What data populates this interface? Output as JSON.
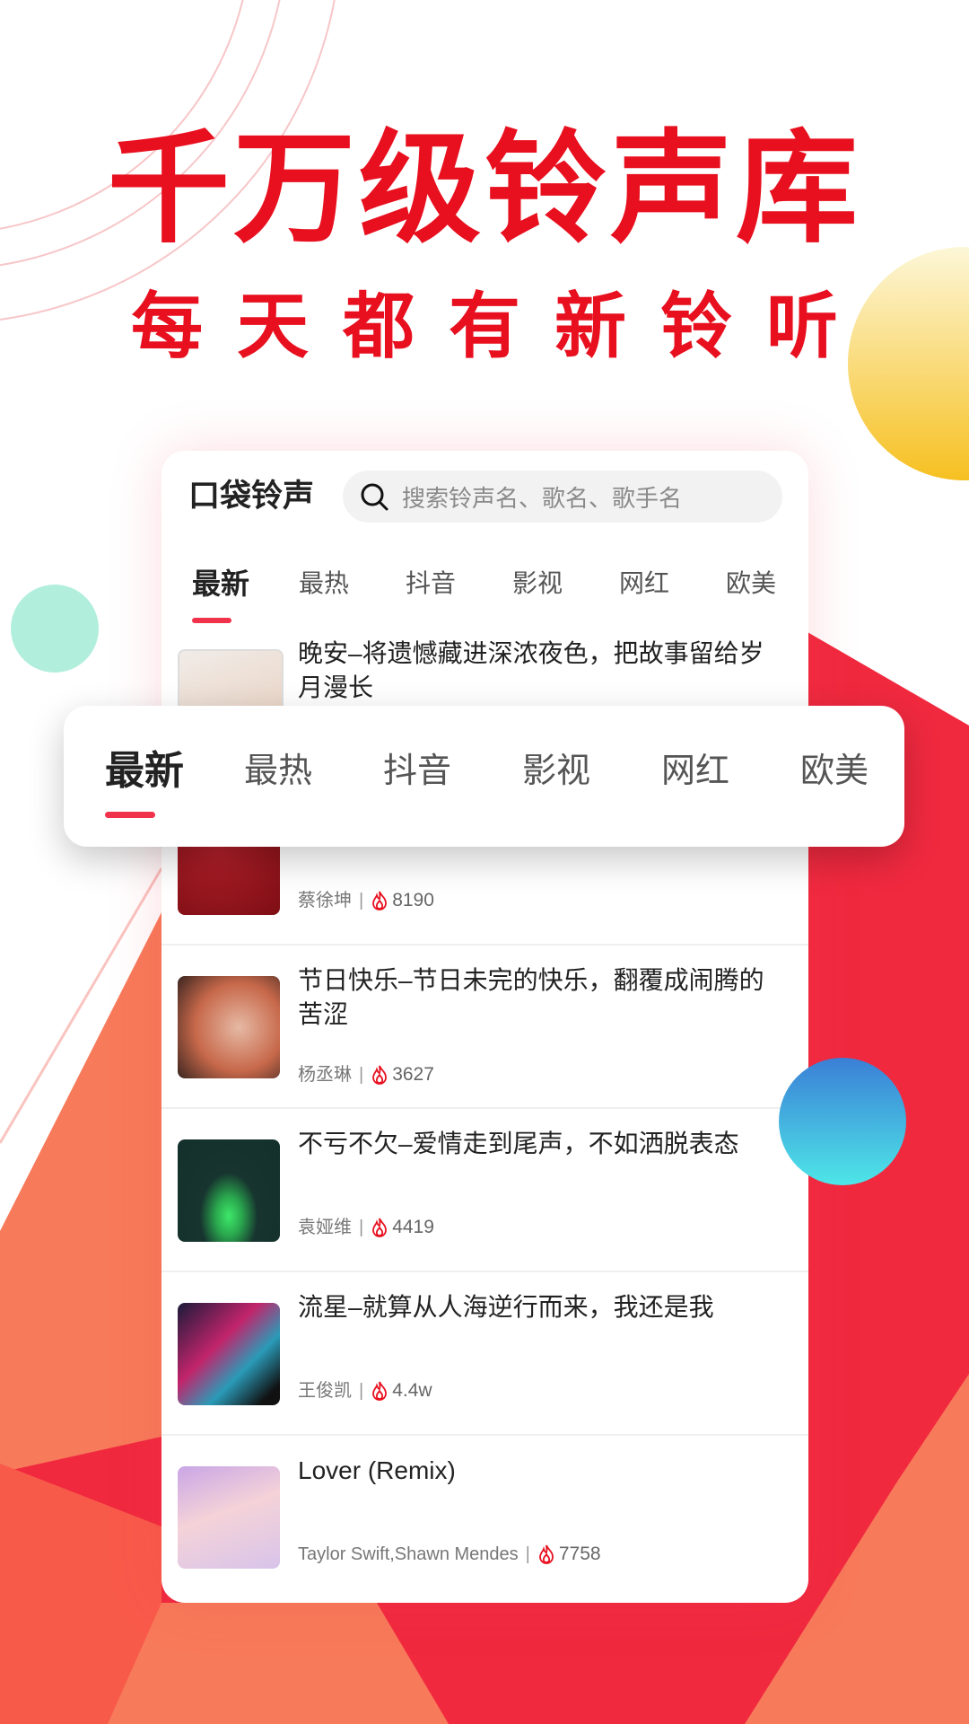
{
  "promo": {
    "headline": "千万级铃声库",
    "subheadline": "每天都有新铃听",
    "accent_color": "#e8101f"
  },
  "app": {
    "name": "口袋铃声",
    "search_placeholder": "搜索铃声名、歌名、歌手名",
    "search_icon": "search-icon"
  },
  "tabs": [
    {
      "label": "最新",
      "active": true
    },
    {
      "label": "最热",
      "active": false
    },
    {
      "label": "抖音",
      "active": false
    },
    {
      "label": "影视",
      "active": false
    },
    {
      "label": "网红",
      "active": false
    },
    {
      "label": "欧美",
      "active": false
    }
  ],
  "songs": [
    {
      "title": "晚安–将遗憾藏进深浓夜色，把故事留给岁月漫长",
      "artist": "",
      "plays": ""
    },
    {
      "title": "",
      "artist": "蔡徐坤",
      "plays": "8190"
    },
    {
      "title": "节日快乐–节日未完的快乐，翻覆成闹腾的苦涩",
      "artist": "杨丞琳",
      "plays": "3627"
    },
    {
      "title": "不亏不欠–爱情走到尾声，不如洒脱表态",
      "artist": "袁娅维",
      "plays": "4419"
    },
    {
      "title": "流星–就算从人海逆行而来，我还是我",
      "artist": "王俊凯",
      "plays": "4.4w"
    },
    {
      "title": "Lover (Remix)",
      "artist": "Taylor Swift,Shawn Mendes",
      "plays": "7758"
    }
  ],
  "meta_separator": "|",
  "hot_icon": "flame-icon",
  "colors": {
    "tab_underline": "#f0334a",
    "background_red": "#f0293f",
    "background_coral": "#f77a5a"
  }
}
